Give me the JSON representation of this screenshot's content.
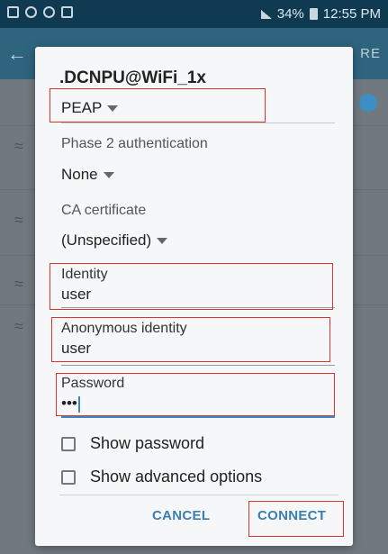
{
  "status_bar": {
    "battery": "34%",
    "time": "12:55 PM"
  },
  "app_bar": {
    "back_icon": "←",
    "action": "RE"
  },
  "dialog": {
    "title": ".DCNPU@WiFi_1x",
    "eap_method": "PEAP",
    "phase2": {
      "label": "Phase 2 authentication",
      "value": "None"
    },
    "ca_certificate": {
      "label": "CA certificate",
      "value": "(Unspecified)"
    },
    "identity": {
      "label": "Identity",
      "value": "user"
    },
    "anonymous_identity": {
      "label": "Anonymous identity",
      "value": "user"
    },
    "password": {
      "label": "Password",
      "value": "•••"
    },
    "show_password": "Show password",
    "show_advanced": "Show advanced options",
    "cancel": "CANCEL",
    "connect": "CONNECT"
  },
  "highlight_color": "#e03131",
  "accent_color": "#3b7fb0"
}
